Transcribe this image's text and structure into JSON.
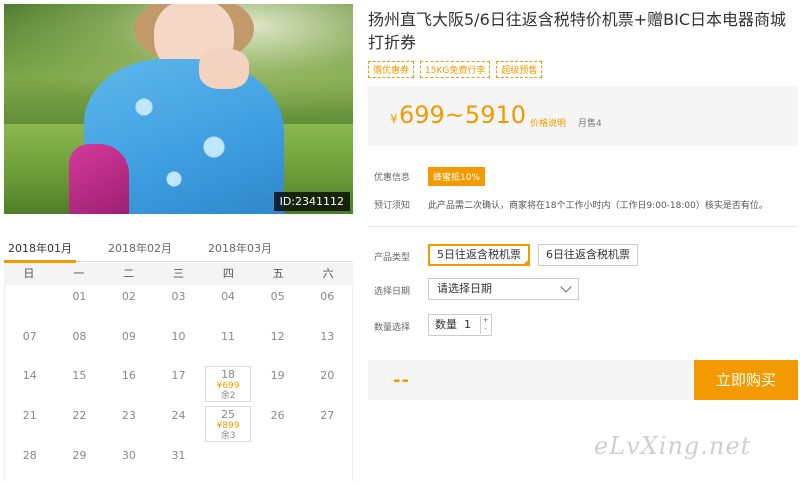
{
  "photo": {
    "id_label": "ID:2341112"
  },
  "calendar": {
    "tabs": [
      "2018年01月",
      "2018年02月",
      "2018年03月"
    ],
    "weekdays": [
      "日",
      "一",
      "二",
      "三",
      "四",
      "五",
      "六"
    ],
    "days": [
      {
        "d": ""
      },
      {
        "d": "01"
      },
      {
        "d": "02"
      },
      {
        "d": "03"
      },
      {
        "d": "04"
      },
      {
        "d": "05"
      },
      {
        "d": "06"
      },
      {
        "d": "07"
      },
      {
        "d": "08"
      },
      {
        "d": "09"
      },
      {
        "d": "10"
      },
      {
        "d": "11"
      },
      {
        "d": "12"
      },
      {
        "d": "13"
      },
      {
        "d": "14"
      },
      {
        "d": "15"
      },
      {
        "d": "16"
      },
      {
        "d": "17"
      },
      {
        "d": "18",
        "price": "¥699",
        "remain": "余2"
      },
      {
        "d": "19"
      },
      {
        "d": "20"
      },
      {
        "d": "21"
      },
      {
        "d": "22"
      },
      {
        "d": "23"
      },
      {
        "d": "24"
      },
      {
        "d": "25",
        "price": "¥899",
        "remain": "余3"
      },
      {
        "d": "26"
      },
      {
        "d": "27"
      },
      {
        "d": "28"
      },
      {
        "d": "29"
      },
      {
        "d": "30"
      },
      {
        "d": "31"
      },
      {
        "d": ""
      },
      {
        "d": ""
      },
      {
        "d": ""
      }
    ]
  },
  "product": {
    "title": "扬州直飞大阪5/6日往返含税特价机票+赠BIC日本电器商城打折券",
    "tags": [
      "赠优惠券",
      "15KG免费行李",
      "超级预售"
    ],
    "price_symbol": "¥",
    "price_range": "699~5910",
    "price_note": "价格说明",
    "monthly_sales": "月售4"
  },
  "info": {
    "discount_label": "优惠信息",
    "discount_badge": "蜂蜜抵10%",
    "notice_label": "预订须知",
    "notice_text": "此产品需二次确认，商家将在18个工作小时内（工作日9:00-18:00）核实是否有位。"
  },
  "options": {
    "type_label": "产品类型",
    "types": [
      "5日往返含税机票",
      "6日往返含税机票"
    ],
    "date_label": "选择日期",
    "date_placeholder": "请选择日期",
    "qty_label": "数量选择",
    "qty_prefix": "数量",
    "qty_value": "1",
    "qty_up": "+",
    "qty_down": "-"
  },
  "purchase": {
    "total": "--",
    "buy_label": "立即购买"
  },
  "watermark": "eLvXing.net",
  "colors": {
    "accent": "#f39a00"
  }
}
